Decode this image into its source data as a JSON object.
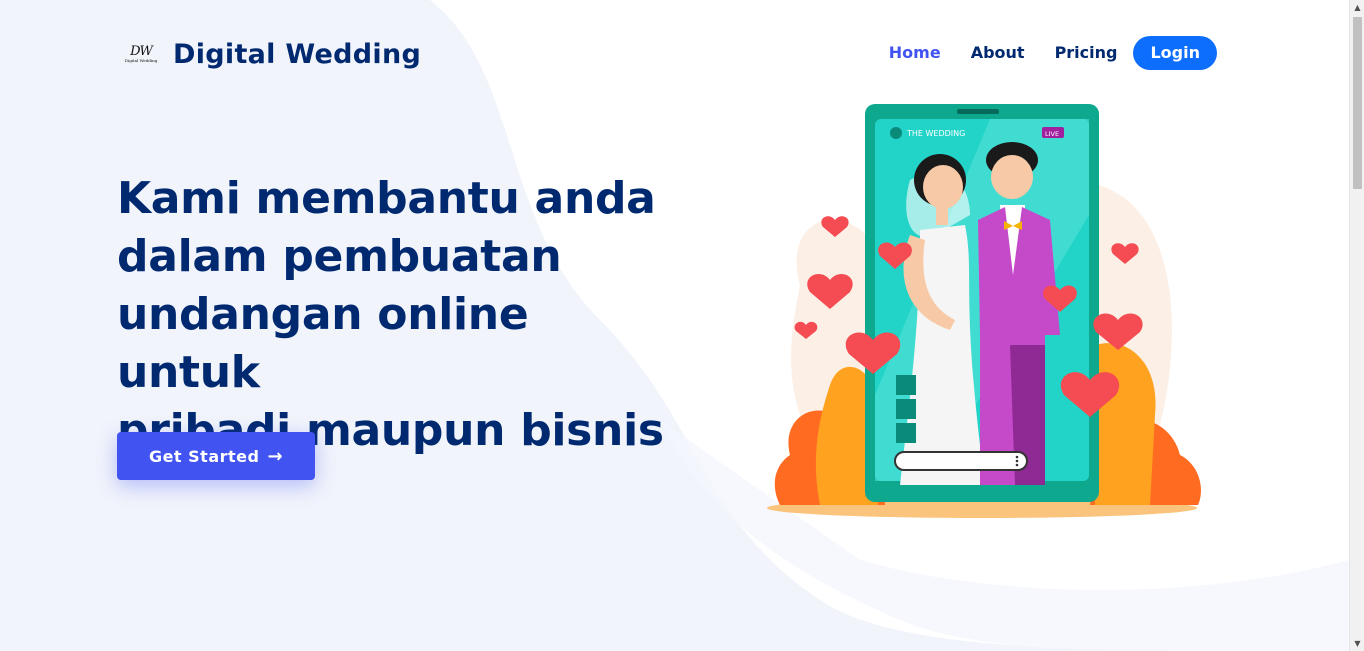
{
  "brand": {
    "name": "Digital Wedding",
    "logo_mark": "DW",
    "logo_sub": "Digital Wedding"
  },
  "nav": {
    "items": [
      {
        "label": "Home",
        "active": true
      },
      {
        "label": "About",
        "active": false
      },
      {
        "label": "Pricing",
        "active": false
      }
    ],
    "login_label": "Login"
  },
  "hero": {
    "headline_lines": [
      "Kami membantu anda",
      "dalam pembuatan",
      "undangan online untuk",
      "pribadi maupun bisnis"
    ],
    "cta_label": "Get Started",
    "cta_icon": "arrow-right-icon"
  },
  "illustration": {
    "screen_title": "THE WEDDING",
    "live_badge": "LIVE"
  },
  "colors": {
    "brand_navy": "#012970",
    "accent": "#4154f1",
    "login_blue": "#0d6efd",
    "phone_teal": "#0ea88f",
    "screen_cyan": "#22d3c8"
  }
}
